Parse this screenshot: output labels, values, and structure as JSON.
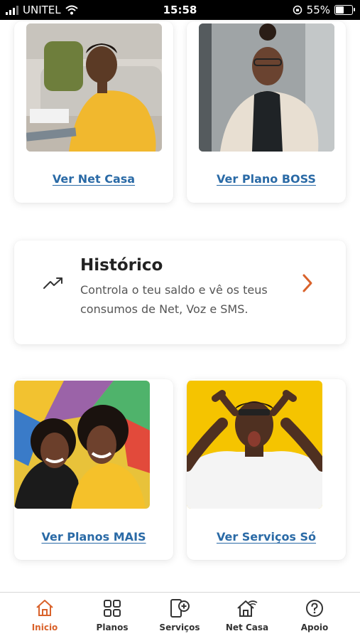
{
  "status_bar": {
    "carrier": "UNITEL",
    "time": "15:58",
    "battery": "55%"
  },
  "cards": {
    "net_casa": {
      "link": "Ver Net Casa"
    },
    "plano_boss": {
      "link": "Ver Plano BOSS"
    },
    "planos_mais": {
      "link": "Ver Planos MAIS"
    },
    "servicos_so": {
      "link": "Ver Serviços Só"
    }
  },
  "historico": {
    "title": "Histórico",
    "description": "Controla o teu saldo e vê os teus consumos de Net, Voz e SMS."
  },
  "bottom_nav": {
    "items": [
      {
        "label": "Inicio",
        "icon": "home-icon",
        "active": true
      },
      {
        "label": "Planos",
        "icon": "grid-icon"
      },
      {
        "label": "Serviços",
        "icon": "phone-plus-icon"
      },
      {
        "label": "Net Casa",
        "icon": "home-wifi-icon"
      },
      {
        "label": "Apoio",
        "icon": "help-icon"
      }
    ]
  },
  "colors": {
    "accent": "#d9622b",
    "link": "#2a6aa6",
    "photo_yellow": "#f5c400"
  }
}
